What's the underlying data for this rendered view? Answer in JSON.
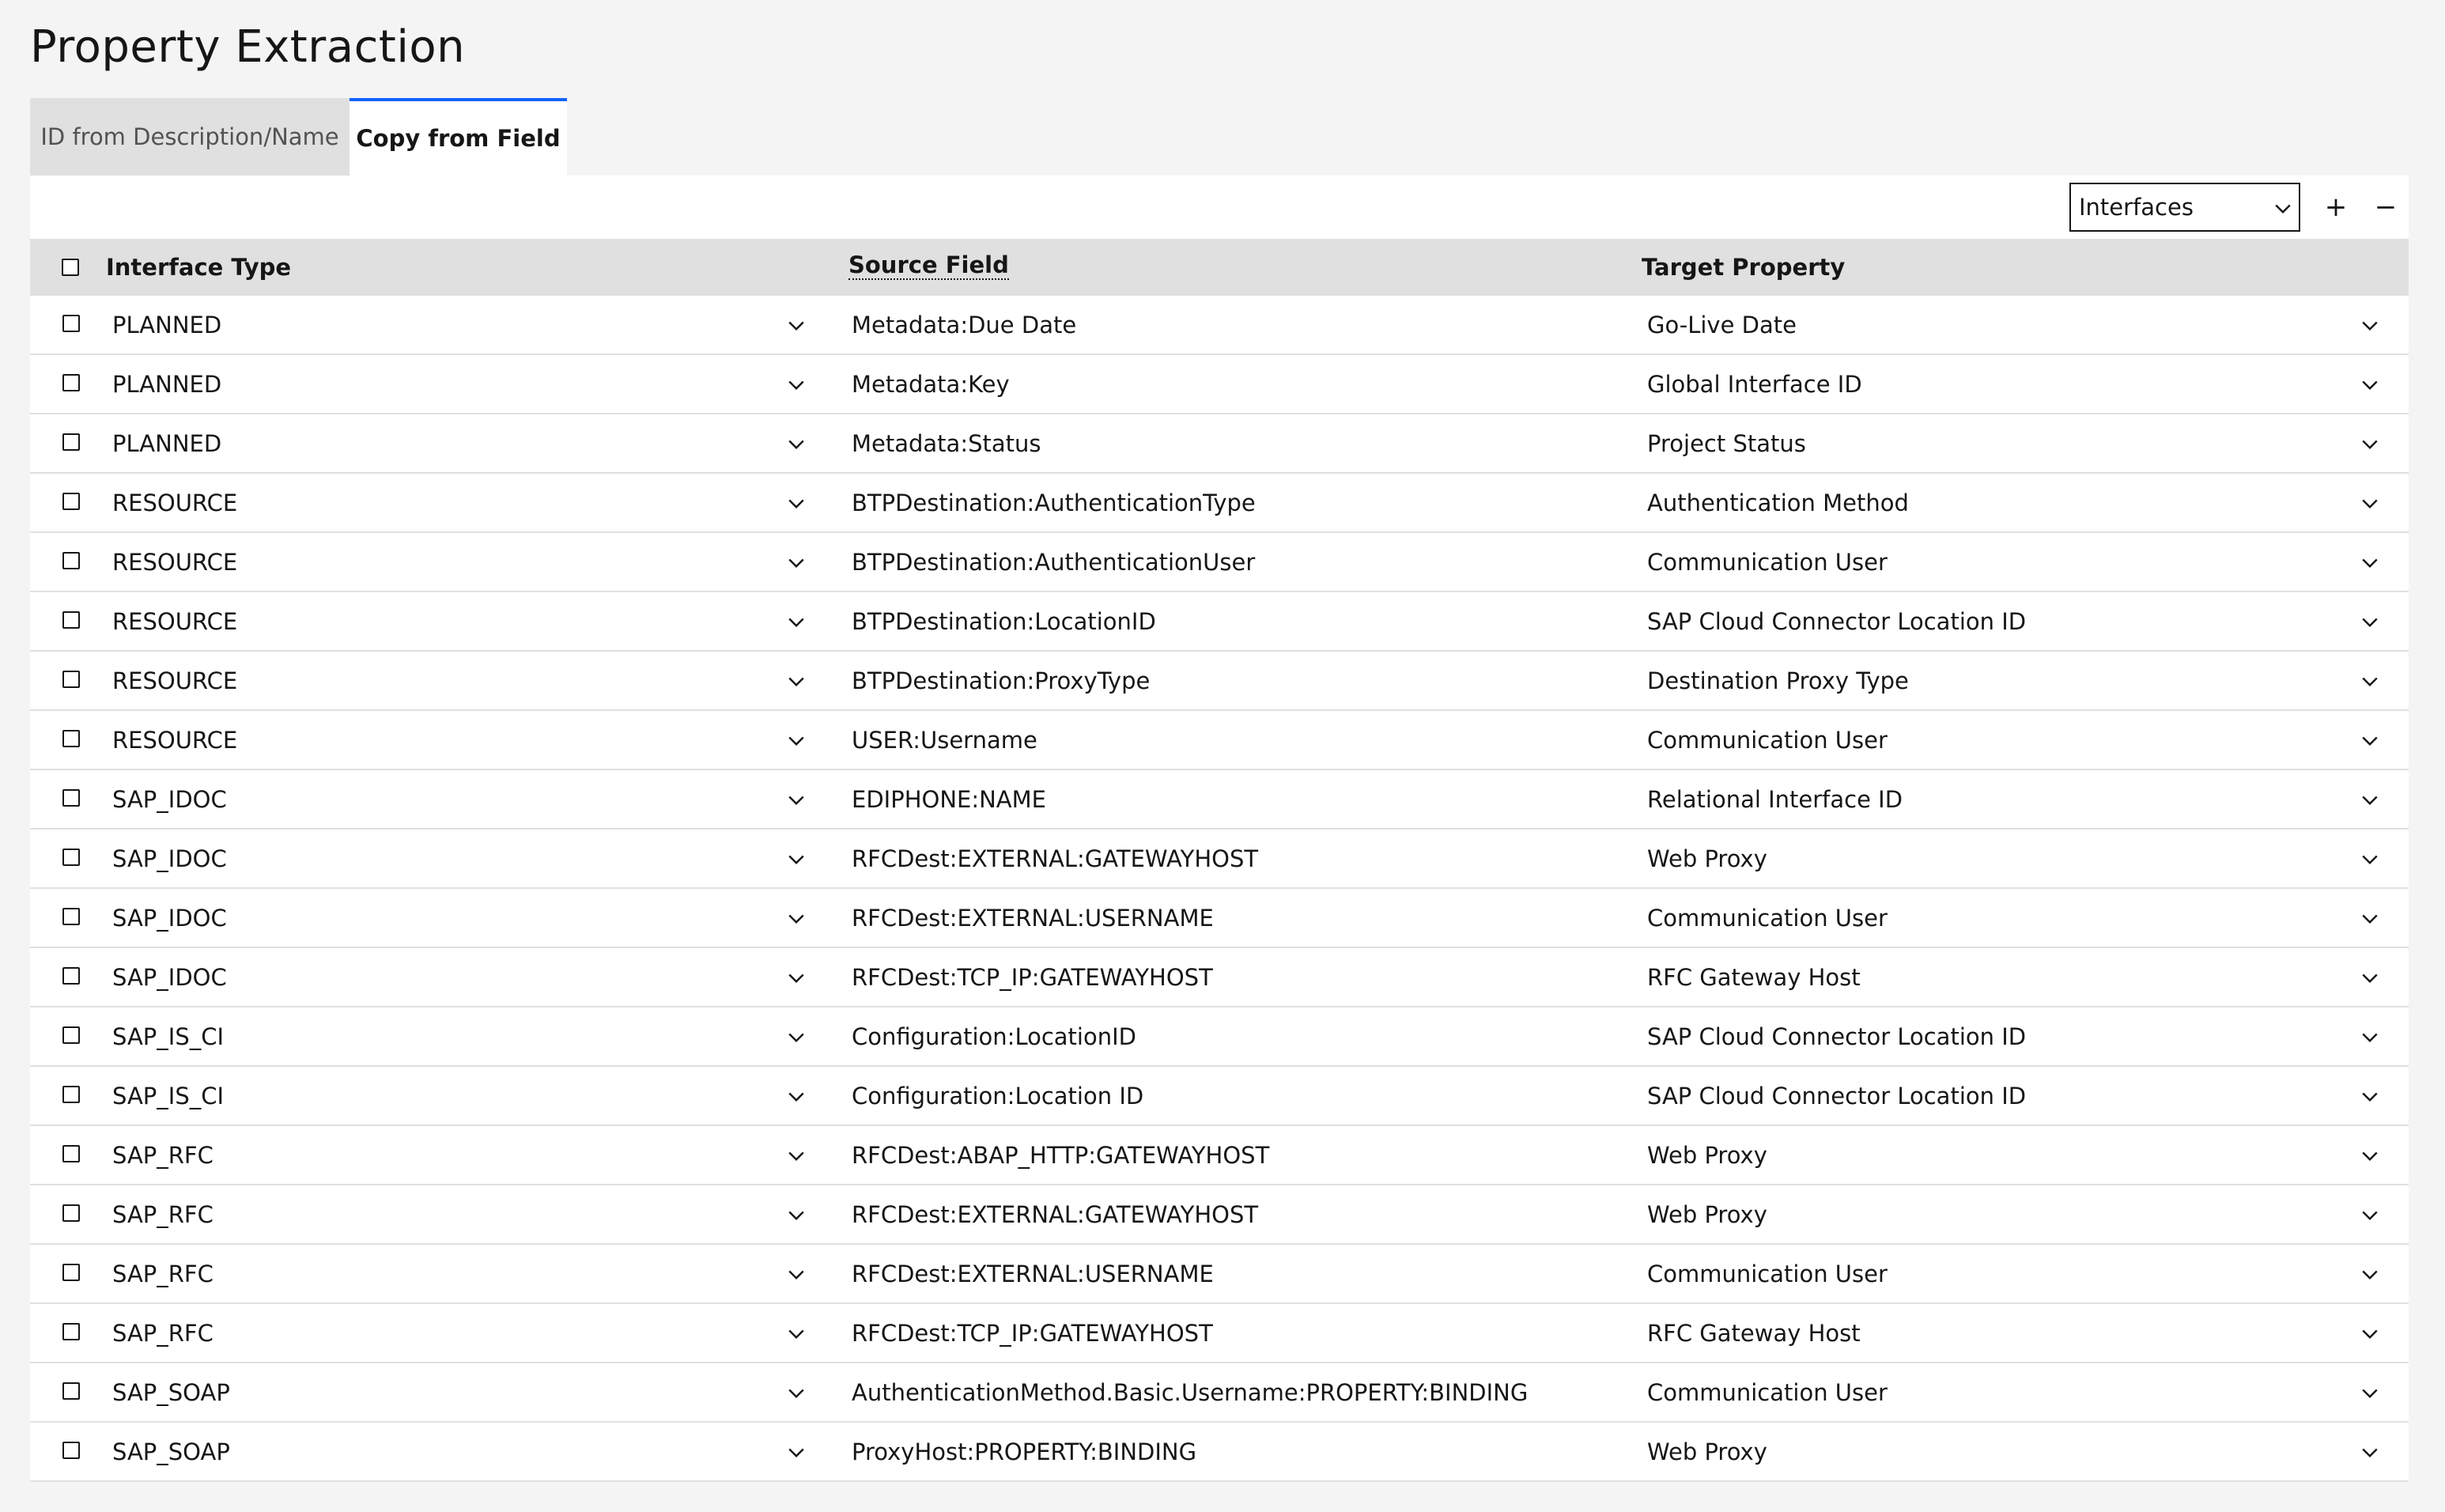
{
  "page": {
    "title": "Property Extraction"
  },
  "tabs": [
    {
      "label": "ID from Description/Name",
      "active": false
    },
    {
      "label": "Copy from Field",
      "active": true
    }
  ],
  "toolbar": {
    "select_value": "Interfaces",
    "add_label": "+",
    "remove_label": "−"
  },
  "table": {
    "columns": {
      "type": "Interface Type",
      "source": "Source Field",
      "target": "Target Property"
    },
    "rows": [
      {
        "type": "PLANNED",
        "source": "Metadata:Due Date",
        "target": "Go-Live Date"
      },
      {
        "type": "PLANNED",
        "source": "Metadata:Key",
        "target": "Global Interface ID"
      },
      {
        "type": "PLANNED",
        "source": "Metadata:Status",
        "target": "Project Status"
      },
      {
        "type": "RESOURCE",
        "source": "BTPDestination:AuthenticationType",
        "target": "Authentication Method"
      },
      {
        "type": "RESOURCE",
        "source": "BTPDestination:AuthenticationUser",
        "target": "Communication User"
      },
      {
        "type": "RESOURCE",
        "source": "BTPDestination:LocationID",
        "target": "SAP Cloud Connector Location ID"
      },
      {
        "type": "RESOURCE",
        "source": "BTPDestination:ProxyType",
        "target": "Destination Proxy Type"
      },
      {
        "type": "RESOURCE",
        "source": "USER:Username",
        "target": "Communication User"
      },
      {
        "type": "SAP_IDOC",
        "source": "EDIPHONE:NAME",
        "target": "Relational Interface ID"
      },
      {
        "type": "SAP_IDOC",
        "source": "RFCDest:EXTERNAL:GATEWAYHOST",
        "target": "Web Proxy"
      },
      {
        "type": "SAP_IDOC",
        "source": "RFCDest:EXTERNAL:USERNAME",
        "target": "Communication User"
      },
      {
        "type": "SAP_IDOC",
        "source": "RFCDest:TCP_IP:GATEWAYHOST",
        "target": "RFC Gateway Host"
      },
      {
        "type": "SAP_IS_CI",
        "source": "Configuration:LocationID",
        "target": "SAP Cloud Connector Location ID"
      },
      {
        "type": "SAP_IS_CI",
        "source": "Configuration:Location ID",
        "target": "SAP Cloud Connector Location ID"
      },
      {
        "type": "SAP_RFC",
        "source": "RFCDest:ABAP_HTTP:GATEWAYHOST",
        "target": "Web Proxy"
      },
      {
        "type": "SAP_RFC",
        "source": "RFCDest:EXTERNAL:GATEWAYHOST",
        "target": "Web Proxy"
      },
      {
        "type": "SAP_RFC",
        "source": "RFCDest:EXTERNAL:USERNAME",
        "target": "Communication User"
      },
      {
        "type": "SAP_RFC",
        "source": "RFCDest:TCP_IP:GATEWAYHOST",
        "target": "RFC Gateway Host"
      },
      {
        "type": "SAP_SOAP",
        "source": "AuthenticationMethod.Basic.Username:PROPERTY:BINDING",
        "target": "Communication User"
      },
      {
        "type": "SAP_SOAP",
        "source": "ProxyHost:PROPERTY:BINDING",
        "target": "Web Proxy"
      }
    ]
  }
}
